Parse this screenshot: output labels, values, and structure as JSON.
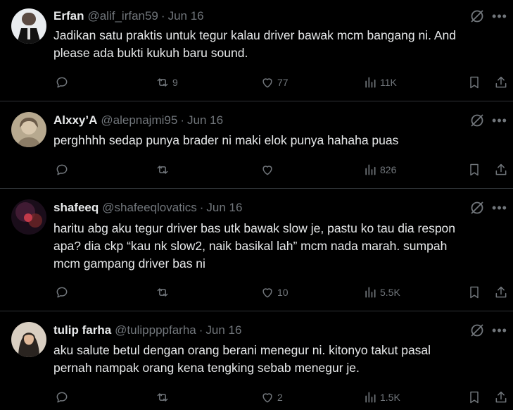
{
  "colors": {
    "background": "#000000",
    "text": "#e7e9ea",
    "muted": "#71767b",
    "divider": "#2f3336"
  },
  "icons": {
    "reply": "reply-icon",
    "retweet": "retweet-icon",
    "like": "heart-icon",
    "views": "views-icon",
    "bookmark": "bookmark-icon",
    "share": "share-icon",
    "grok": "grok-icon",
    "more": "more-icon"
  },
  "tweets": [
    {
      "name": "Erfan",
      "handle": "@alif_irfan59",
      "sep": "·",
      "date": "Jun 16",
      "text": "Jadikan satu praktis untuk tegur kalau driver bawak mcm bangang ni. And\nplease ada bukti kukuh baru sound.",
      "replies": "",
      "retweets": "9",
      "likes": "77",
      "views": "11K"
    },
    {
      "name": "Alxxy’A",
      "handle": "@alepnajmi95",
      "sep": "·",
      "date": "Jun 16",
      "text": "perghhhh sedap punya brader ni maki elok punya hahaha puas",
      "replies": "",
      "retweets": "",
      "likes": "",
      "views": "826"
    },
    {
      "name": "shafeeq",
      "handle": "@shafeeqlovatics",
      "sep": "·",
      "date": "Jun 16",
      "text": "haritu abg aku tegur driver bas utk bawak slow je, pastu ko tau dia respon\napa? dia ckp “kau nk slow2, naik basikal lah” mcm nada marah. sumpah\nmcm gampang driver bas ni",
      "replies": "",
      "retweets": "",
      "likes": "10",
      "views": "5.5K"
    },
    {
      "name": "tulip farha",
      "handle": "@tulippppfarha",
      "sep": "·",
      "date": "Jun 16",
      "text": "aku salute betul dengan orang berani menegur ni. kitonyo takut pasal\npernah nampak orang kena tengking sebab menegur je.",
      "replies": "",
      "retweets": "",
      "likes": "2",
      "views": "1.5K"
    }
  ]
}
